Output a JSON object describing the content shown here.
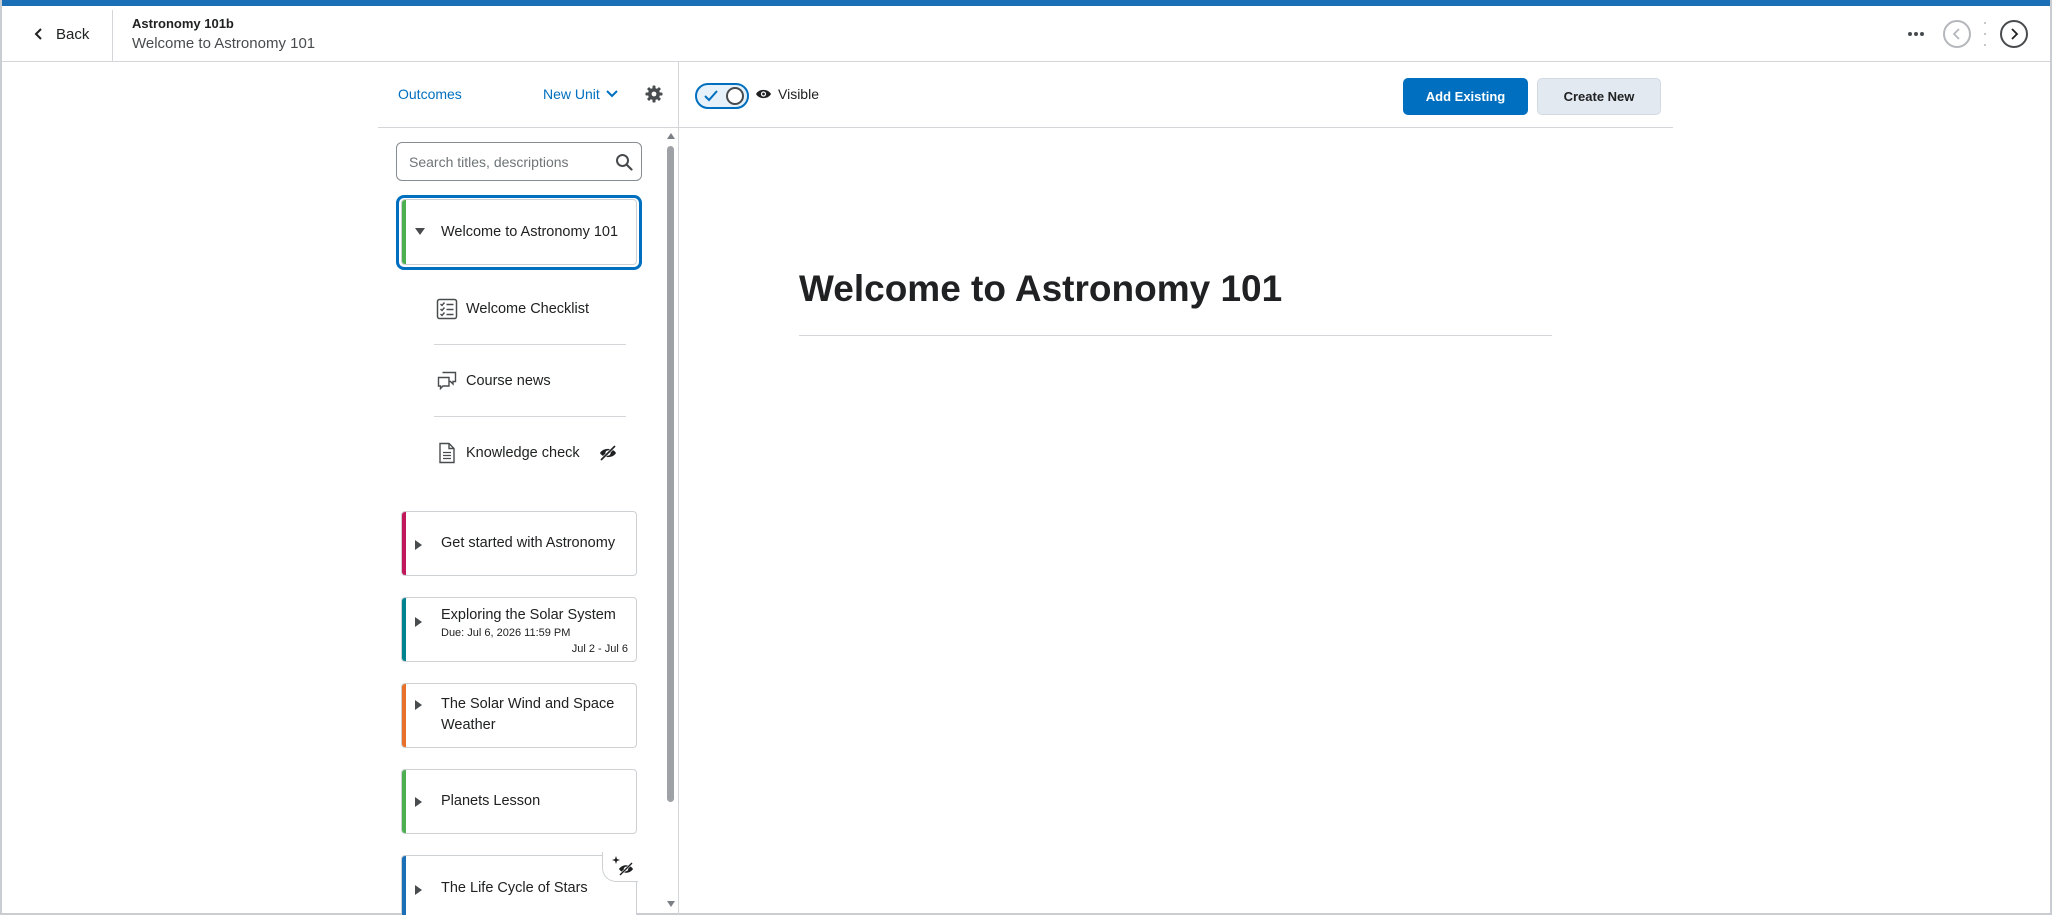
{
  "header": {
    "back_label": "Back",
    "course_title": "Astronomy 101b",
    "page_subtitle": "Welcome to Astronomy 101"
  },
  "left_toolbar": {
    "outcomes_label": "Outcomes",
    "new_unit_label": "New Unit"
  },
  "right_toolbar": {
    "visibility_label": "Visible",
    "visibility_on": true,
    "add_existing_label": "Add Existing",
    "create_new_label": "Create New"
  },
  "search": {
    "placeholder": "Search titles, descriptions",
    "value": ""
  },
  "units": [
    {
      "title": "Welcome to Astronomy 101",
      "accent": "#4caf50",
      "expanded": true,
      "selected": true
    },
    {
      "title": "Get started with Astronomy",
      "accent": "#c2185b",
      "expanded": false
    },
    {
      "title": "Exploring the Solar System",
      "accent": "#00838f",
      "due": "Due: Jul 6, 2026 11:59 PM",
      "range": "Jul 2 - Jul 6",
      "expanded": false
    },
    {
      "title": "The Solar Wind and Space Weather",
      "accent": "#e8702a",
      "expanded": false
    },
    {
      "title": "Planets Lesson",
      "accent": "#4caf50",
      "expanded": false
    },
    {
      "title": "The Life Cycle of Stars",
      "accent": "#1a6fb6",
      "expanded": false
    }
  ],
  "topics": [
    {
      "label": "Welcome Checklist",
      "icon": "checklist-icon"
    },
    {
      "label": "Course news",
      "icon": "discussion-icon"
    },
    {
      "label": "Knowledge check",
      "icon": "document-icon",
      "hidden": true
    }
  ],
  "main": {
    "title": "Welcome to Astronomy 101"
  },
  "colors": {
    "brand": "#006fbf",
    "top_accent": "#1a6fb6"
  }
}
